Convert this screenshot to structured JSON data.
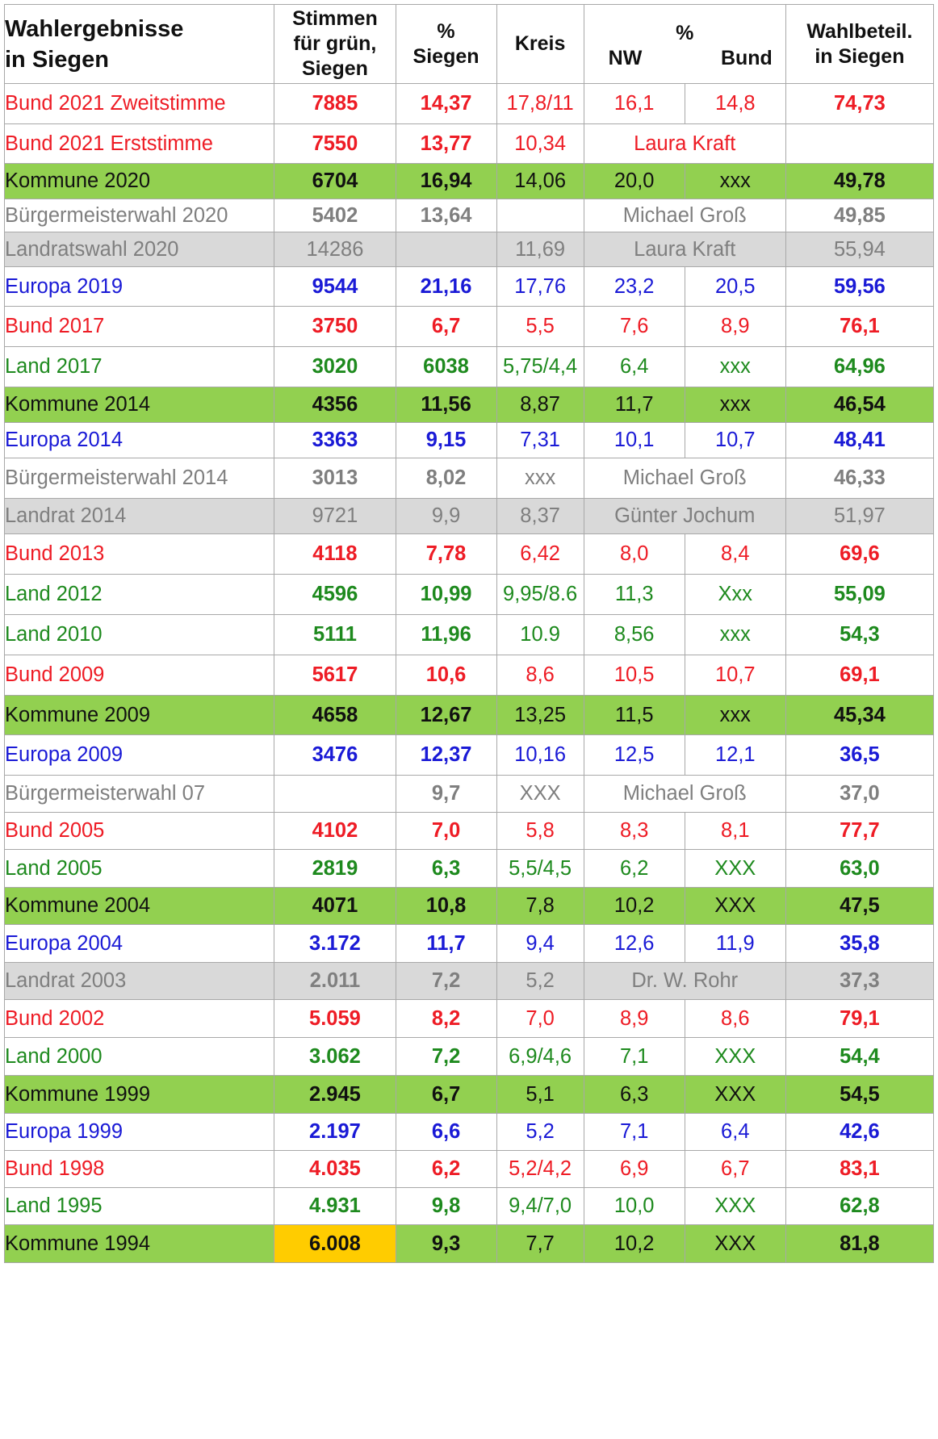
{
  "header": {
    "title_line1": "Wahlergebnisse",
    "title_line2": "in Siegen",
    "col_votes_1": "Stimmen",
    "col_votes_2": "für grün,",
    "col_votes_3": "Siegen",
    "col_pct_1": "%",
    "col_pct_2": "Siegen",
    "col_kreis": "Kreis",
    "col_nw_1": "%",
    "col_nw_2": "NW",
    "col_bund": "Bund",
    "col_turnout_1": "Wahlbeteil.",
    "col_turnout_2": "in Siegen"
  },
  "colors": {
    "red": "#ee1c25",
    "blue": "#1a1ad6",
    "green_text": "#1e8a1e",
    "gray_text": "#7f7f7f",
    "dark": "#111111",
    "row_green": "#92d050",
    "row_gray": "#d9d9d9",
    "highlight": "#ffcc00"
  },
  "rows": [
    {
      "label": "Bund 2021 Zweitstimme",
      "votes": "7885",
      "pct": "14,37",
      "kreis": "17,8/11",
      "nw": "16,1",
      "bund": "14,8",
      "turnout": "74,73",
      "color": "red",
      "bg": "white"
    },
    {
      "label": "Bund 2021 Erststimme",
      "votes": "7550",
      "pct": "13,77",
      "kreis": "10,34",
      "candidate": "Laura Kraft",
      "turnout": "",
      "color": "red",
      "bg": "white"
    },
    {
      "label": "Kommune 2020",
      "votes": "6704",
      "pct": "16,94",
      "kreis": "14,06",
      "nw": "20,0",
      "bund": "xxx",
      "turnout": "49,78",
      "color": "dark",
      "bg": "green"
    },
    {
      "label": "Bürgermeisterwahl 2020",
      "votes": "5402",
      "pct": "13,64",
      "kreis": "",
      "candidate": "Michael Groß",
      "turnout": "49,85",
      "color": "gray",
      "bg": "white"
    },
    {
      "label": "Landratswahl 2020",
      "votes": "14286",
      "pct": "",
      "kreis": "11,69",
      "candidate": "Laura Kraft",
      "turnout": "55,94",
      "color": "gray",
      "bg": "gray",
      "plain": true
    },
    {
      "label": "Europa 2019",
      "votes": "9544",
      "pct": "21,16",
      "kreis": "17,76",
      "nw": "23,2",
      "bund": "20,5",
      "turnout": "59,56",
      "color": "blue",
      "bg": "white"
    },
    {
      "label": "Bund 2017",
      "votes": "3750",
      "pct": "6,7",
      "kreis": "5,5",
      "nw": "7,6",
      "bund": "8,9",
      "turnout": "76,1",
      "color": "red",
      "bg": "white"
    },
    {
      "label": "Land 2017",
      "votes": "3020",
      "pct": "6038",
      "kreis": "5,75/4,4",
      "nw": "6,4",
      "bund": "xxx",
      "turnout": "64,96",
      "color": "green",
      "bg": "white"
    },
    {
      "label": "Kommune 2014",
      "votes": "4356",
      "pct": "11,56",
      "kreis": "8,87",
      "nw": "11,7",
      "bund": "xxx",
      "turnout": "46,54",
      "color": "dark",
      "bg": "green"
    },
    {
      "label": "Europa 2014",
      "votes": "3363",
      "pct": "9,15",
      "kreis": "7,31",
      "nw": "10,1",
      "bund": "10,7",
      "turnout": "48,41",
      "color": "blue",
      "bg": "white"
    },
    {
      "label": "Bürgermeisterwahl 2014",
      "votes": "3013",
      "pct": "8,02",
      "kreis": "xxx",
      "candidate": "Michael Groß",
      "turnout": "46,33",
      "color": "gray",
      "bg": "white"
    },
    {
      "label": "Landrat 2014",
      "votes": "9721",
      "pct": "9,9",
      "kreis": "8,37",
      "candidate": "Günter Jochum",
      "turnout": "51,97",
      "color": "gray",
      "bg": "gray",
      "plain": true
    },
    {
      "label": "Bund 2013",
      "votes": "4118",
      "pct": "7,78",
      "kreis": "6,42",
      "nw": "8,0",
      "bund": "8,4",
      "turnout": "69,6",
      "color": "red",
      "bg": "white"
    },
    {
      "label": "Land 2012",
      "votes": "4596",
      "pct": "10,99",
      "kreis": "9,95/8.6",
      "nw": "11,3",
      "bund": "Xxx",
      "turnout": "55,09",
      "color": "green",
      "bg": "white"
    },
    {
      "label": "Land 2010",
      "votes": "5111",
      "pct": "11,96",
      "kreis": "10.9",
      "nw": "8,56",
      "bund": "xxx",
      "turnout": "54,3",
      "color": "green",
      "bg": "white"
    },
    {
      "label": "Bund 2009",
      "votes": "5617",
      "pct": "10,6",
      "kreis": "8,6",
      "nw": "10,5",
      "bund": "10,7",
      "turnout": "69,1",
      "color": "red",
      "bg": "white"
    },
    {
      "label": "Kommune 2009",
      "votes": "4658",
      "pct": "12,67",
      "kreis": "13,25",
      "nw": "11,5",
      "bund": "xxx",
      "turnout": "45,34",
      "color": "dark",
      "bg": "green"
    },
    {
      "label": "Europa 2009",
      "votes": "3476",
      "pct": "12,37",
      "kreis": "10,16",
      "nw": "12,5",
      "bund": "12,1",
      "turnout": "36,5",
      "color": "blue",
      "bg": "white"
    },
    {
      "label": "Bürgermeisterwahl 07",
      "votes": "",
      "pct": "9,7",
      "kreis": "XXX",
      "candidate": "Michael Groß",
      "turnout": "37,0",
      "color": "gray",
      "bg": "white"
    },
    {
      "label": "Bund 2005",
      "votes": "4102",
      "pct": "7,0",
      "kreis": "5,8",
      "nw": "8,3",
      "bund": "8,1",
      "turnout": "77,7",
      "color": "red",
      "bg": "white"
    },
    {
      "label": "Land 2005",
      "votes": "2819",
      "pct": "6,3",
      "kreis": "5,5/4,5",
      "nw": "6,2",
      "bund": "XXX",
      "turnout": "63,0",
      "color": "green",
      "bg": "white"
    },
    {
      "label": "Kommune 2004",
      "votes": "4071",
      "pct": "10,8",
      "kreis": "7,8",
      "nw": "10,2",
      "bund": "XXX",
      "turnout": "47,5",
      "color": "dark",
      "bg": "green"
    },
    {
      "label": "Europa 2004",
      "votes": "3.172",
      "pct": "11,7",
      "kreis": "9,4",
      "nw": "12,6",
      "bund": "11,9",
      "turnout": "35,8",
      "color": "blue",
      "bg": "white"
    },
    {
      "label": "Landrat 2003",
      "votes": "2.011",
      "pct": "7,2",
      "kreis": "5,2",
      "candidate": "Dr. W. Rohr",
      "turnout": "37,3",
      "color": "gray",
      "bg": "gray"
    },
    {
      "label": "Bund 2002",
      "votes": "5.059",
      "pct": "8,2",
      "kreis": "7,0",
      "nw": "8,9",
      "bund": "8,6",
      "turnout": "79,1",
      "color": "red",
      "bg": "white"
    },
    {
      "label": "Land 2000",
      "votes": "3.062",
      "pct": "7,2",
      "kreis": "6,9/4,6",
      "nw": "7,1",
      "bund": "XXX",
      "turnout": "54,4",
      "color": "green",
      "bg": "white"
    },
    {
      "label": "Kommune 1999",
      "votes": "2.945",
      "pct": "6,7",
      "kreis": "5,1",
      "nw": "6,3",
      "bund": "XXX",
      "turnout": "54,5",
      "color": "dark",
      "bg": "green"
    },
    {
      "label": "Europa 1999",
      "votes": "2.197",
      "pct": "6,6",
      "kreis": "5,2",
      "nw": "7,1",
      "bund": "6,4",
      "turnout": "42,6",
      "color": "blue",
      "bg": "white"
    },
    {
      "label": "Bund 1998",
      "votes": "4.035",
      "pct": "6,2",
      "kreis": "5,2/4,2",
      "nw": "6,9",
      "bund": "6,7",
      "turnout": "83,1",
      "color": "red",
      "bg": "white"
    },
    {
      "label": "Land 1995",
      "votes": "4.931",
      "pct": "9,8",
      "kreis": "9,4/7,0",
      "nw": "10,0",
      "bund": "XXX",
      "turnout": "62,8",
      "color": "green",
      "bg": "white"
    },
    {
      "label": "Kommune 1994",
      "votes": "6.008",
      "pct": "9,3",
      "kreis": "7,7",
      "nw": "10,2",
      "bund": "XXX",
      "turnout": "81,8",
      "color": "dark",
      "bg": "green",
      "highlight_votes": true
    }
  ]
}
